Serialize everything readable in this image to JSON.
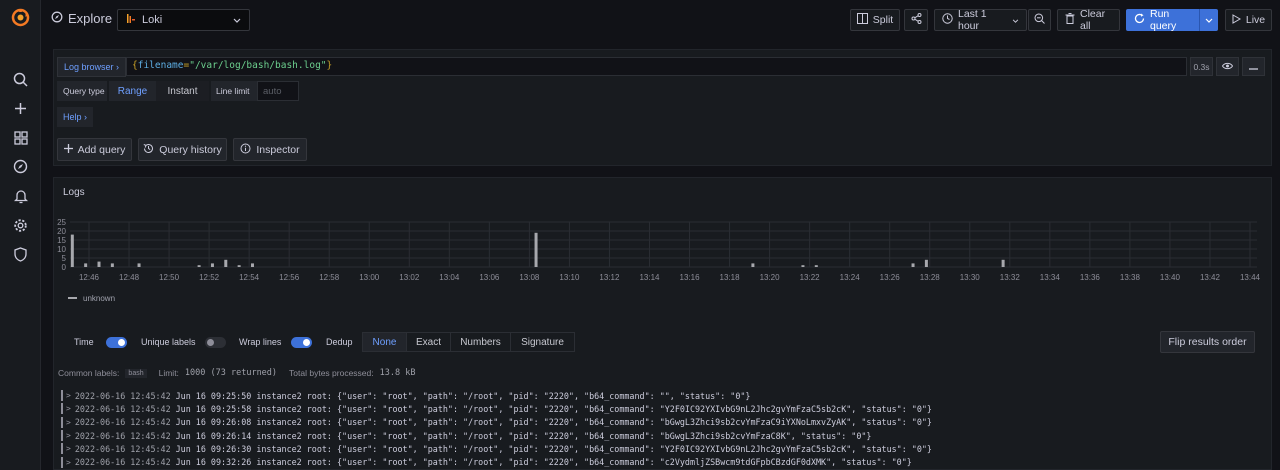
{
  "topbar": {
    "title": "Explore",
    "datasource": "Loki",
    "split_label": "Split",
    "time_range_label": "Last 1 hour",
    "clear_all_label": "Clear all",
    "run_query_label": "Run query",
    "live_label": "Live"
  },
  "query": {
    "log_browser_label": "Log browser ›",
    "open_brace": "{",
    "key": "filename",
    "eq": "=",
    "value": "\"/var/log/bash/bash.log\"",
    "close_brace": "}",
    "duration": "0.3s",
    "query_type_label": "Query type",
    "range_label": "Range",
    "instant_label": "Instant",
    "line_limit_label": "Line limit",
    "line_limit_placeholder": "auto",
    "help_label": "Help ›",
    "add_query_label": "Add query",
    "query_history_label": "Query history",
    "inspector_label": "Inspector"
  },
  "logs": {
    "title": "Logs",
    "legend_label": "unknown",
    "time_label": "Time",
    "unique_labels_label": "Unique labels",
    "wrap_lines_label": "Wrap lines",
    "dedup_label": "Dedup",
    "dedup_options": [
      "None",
      "Exact",
      "Numbers",
      "Signature"
    ],
    "flip_label": "Flip results order",
    "common_labels_label": "Common labels:",
    "common_label_badge": "bash",
    "limit_label": "Limit:",
    "limit_value": "1000 (73 returned)",
    "bytes_label": "Total bytes processed:",
    "bytes_value": "13.8 kB",
    "rows": [
      {
        "ts": "2022-06-16 12:45:42",
        "line": "Jun 16 09:25:50 instance2 root: {\"user\": \"root\", \"path\": \"/root\", \"pid\": \"2220\", \"b64_command\": \"\", \"status\": \"0\"}"
      },
      {
        "ts": "2022-06-16 12:45:42",
        "line": "Jun 16 09:25:58 instance2 root: {\"user\": \"root\", \"path\": \"/root\", \"pid\": \"2220\", \"b64_command\": \"Y2F0IC92YXIvbG9nL2Jhc2gvYmFzaC5sb2cK\", \"status\": \"0\"}"
      },
      {
        "ts": "2022-06-16 12:45:42",
        "line": "Jun 16 09:26:08 instance2 root: {\"user\": \"root\", \"path\": \"/root\", \"pid\": \"2220\", \"b64_command\": \"bGwgL3Zhci9sb2cvYmFzaC9iYXNoLmxvZyAK\", \"status\": \"0\"}"
      },
      {
        "ts": "2022-06-16 12:45:42",
        "line": "Jun 16 09:26:14 instance2 root: {\"user\": \"root\", \"path\": \"/root\", \"pid\": \"2220\", \"b64_command\": \"bGwgL3Zhci9sb2cvYmFzaC8K\", \"status\": \"0\"}"
      },
      {
        "ts": "2022-06-16 12:45:42",
        "line": "Jun 16 09:26:30 instance2 root: {\"user\": \"root\", \"path\": \"/root\", \"pid\": \"2220\", \"b64_command\": \"Y2F0IC92YXIvbG9nL2Jhc2gvYmFzaC5sb2cK\", \"status\": \"0\"}"
      },
      {
        "ts": "2022-06-16 12:45:42",
        "line": "Jun 16 09:32:26 instance2 root: {\"user\": \"root\", \"path\": \"/root\", \"pid\": \"2220\", \"b64_command\": \"c2VydmljZSBwcm9tdGFpbCBzdGF0dXMK\", \"status\": \"0\"}"
      }
    ]
  },
  "chart_data": {
    "type": "bar",
    "series": [
      {
        "name": "unknown"
      }
    ],
    "yticks": [
      "25",
      "20",
      "15",
      "10",
      "5",
      "0"
    ],
    "ylim": [
      0,
      25
    ],
    "xticks": [
      "12:46",
      "12:48",
      "12:50",
      "12:52",
      "12:54",
      "12:56",
      "12:58",
      "13:00",
      "13:02",
      "13:04",
      "13:06",
      "13:08",
      "13:10",
      "13:12",
      "13:14",
      "13:16",
      "13:18",
      "13:20",
      "13:22",
      "13:24",
      "13:26",
      "13:28",
      "13:30",
      "13:32",
      "13:34",
      "13:36",
      "13:38",
      "13:40",
      "13:42",
      "13:44"
    ],
    "bars": [
      {
        "t": "12:45:10",
        "v": 18
      },
      {
        "t": "12:45:50",
        "v": 2
      },
      {
        "t": "12:46:30",
        "v": 3
      },
      {
        "t": "12:47:10",
        "v": 2
      },
      {
        "t": "12:48:30",
        "v": 2
      },
      {
        "t": "12:51:30",
        "v": 1
      },
      {
        "t": "12:52:10",
        "v": 2
      },
      {
        "t": "12:52:50",
        "v": 4
      },
      {
        "t": "12:53:30",
        "v": 1
      },
      {
        "t": "12:54:10",
        "v": 2
      },
      {
        "t": "13:08:20",
        "v": 19
      },
      {
        "t": "13:19:10",
        "v": 2
      },
      {
        "t": "13:21:40",
        "v": 1
      },
      {
        "t": "13:22:20",
        "v": 1
      },
      {
        "t": "13:27:10",
        "v": 2
      },
      {
        "t": "13:27:50",
        "v": 4
      },
      {
        "t": "13:31:40",
        "v": 4
      }
    ]
  },
  "colors": {
    "accent": "#3d71d9",
    "bar": "#a7a8ad",
    "link": "#6e9fff"
  }
}
